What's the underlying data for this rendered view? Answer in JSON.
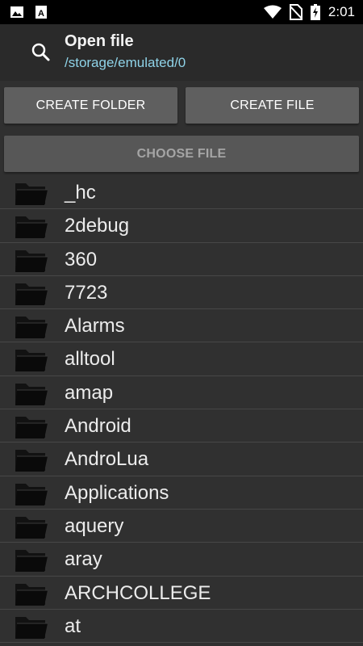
{
  "status_bar": {
    "time": "2:01",
    "icons": [
      "image-icon",
      "a-icon",
      "wifi-icon",
      "no-sim-icon",
      "battery-charging-icon"
    ]
  },
  "header": {
    "title": "Open file",
    "path": "/storage/emulated/0",
    "search_icon": "search-icon"
  },
  "actions": {
    "create_folder": "CREATE FOLDER",
    "create_file": "CREATE FILE",
    "choose_file": "CHOOSE FILE"
  },
  "files": [
    {
      "name": "_hc",
      "icon": "folder-icon"
    },
    {
      "name": "2debug",
      "icon": "folder-icon"
    },
    {
      "name": "360",
      "icon": "folder-icon"
    },
    {
      "name": "7723",
      "icon": "folder-icon"
    },
    {
      "name": "Alarms",
      "icon": "folder-icon"
    },
    {
      "name": "alltool",
      "icon": "folder-icon"
    },
    {
      "name": "amap",
      "icon": "folder-icon"
    },
    {
      "name": "Android",
      "icon": "folder-icon"
    },
    {
      "name": "AndroLua",
      "icon": "folder-icon"
    },
    {
      "name": "Applications",
      "icon": "folder-icon"
    },
    {
      "name": "aquery",
      "icon": "folder-icon"
    },
    {
      "name": "aray",
      "icon": "folder-icon"
    },
    {
      "name": "ARCHCOLLEGE",
      "icon": "folder-icon"
    },
    {
      "name": "at",
      "icon": "folder-icon"
    }
  ],
  "colors": {
    "background": "#303030",
    "header": "#2a2a2a",
    "path_text": "#8fd3e8",
    "button": "#5f5f5f"
  }
}
